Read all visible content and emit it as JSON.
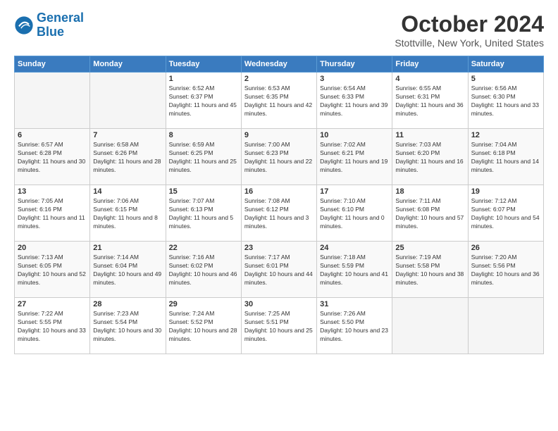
{
  "header": {
    "logo_line1": "General",
    "logo_line2": "Blue",
    "month": "October 2024",
    "location": "Stottville, New York, United States"
  },
  "weekdays": [
    "Sunday",
    "Monday",
    "Tuesday",
    "Wednesday",
    "Thursday",
    "Friday",
    "Saturday"
  ],
  "weeks": [
    [
      {
        "day": "",
        "empty": true
      },
      {
        "day": "",
        "empty": true
      },
      {
        "day": "1",
        "sunrise": "Sunrise: 6:52 AM",
        "sunset": "Sunset: 6:37 PM",
        "daylight": "Daylight: 11 hours and 45 minutes."
      },
      {
        "day": "2",
        "sunrise": "Sunrise: 6:53 AM",
        "sunset": "Sunset: 6:35 PM",
        "daylight": "Daylight: 11 hours and 42 minutes."
      },
      {
        "day": "3",
        "sunrise": "Sunrise: 6:54 AM",
        "sunset": "Sunset: 6:33 PM",
        "daylight": "Daylight: 11 hours and 39 minutes."
      },
      {
        "day": "4",
        "sunrise": "Sunrise: 6:55 AM",
        "sunset": "Sunset: 6:31 PM",
        "daylight": "Daylight: 11 hours and 36 minutes."
      },
      {
        "day": "5",
        "sunrise": "Sunrise: 6:56 AM",
        "sunset": "Sunset: 6:30 PM",
        "daylight": "Daylight: 11 hours and 33 minutes."
      }
    ],
    [
      {
        "day": "6",
        "sunrise": "Sunrise: 6:57 AM",
        "sunset": "Sunset: 6:28 PM",
        "daylight": "Daylight: 11 hours and 30 minutes."
      },
      {
        "day": "7",
        "sunrise": "Sunrise: 6:58 AM",
        "sunset": "Sunset: 6:26 PM",
        "daylight": "Daylight: 11 hours and 28 minutes."
      },
      {
        "day": "8",
        "sunrise": "Sunrise: 6:59 AM",
        "sunset": "Sunset: 6:25 PM",
        "daylight": "Daylight: 11 hours and 25 minutes."
      },
      {
        "day": "9",
        "sunrise": "Sunrise: 7:00 AM",
        "sunset": "Sunset: 6:23 PM",
        "daylight": "Daylight: 11 hours and 22 minutes."
      },
      {
        "day": "10",
        "sunrise": "Sunrise: 7:02 AM",
        "sunset": "Sunset: 6:21 PM",
        "daylight": "Daylight: 11 hours and 19 minutes."
      },
      {
        "day": "11",
        "sunrise": "Sunrise: 7:03 AM",
        "sunset": "Sunset: 6:20 PM",
        "daylight": "Daylight: 11 hours and 16 minutes."
      },
      {
        "day": "12",
        "sunrise": "Sunrise: 7:04 AM",
        "sunset": "Sunset: 6:18 PM",
        "daylight": "Daylight: 11 hours and 14 minutes."
      }
    ],
    [
      {
        "day": "13",
        "sunrise": "Sunrise: 7:05 AM",
        "sunset": "Sunset: 6:16 PM",
        "daylight": "Daylight: 11 hours and 11 minutes."
      },
      {
        "day": "14",
        "sunrise": "Sunrise: 7:06 AM",
        "sunset": "Sunset: 6:15 PM",
        "daylight": "Daylight: 11 hours and 8 minutes."
      },
      {
        "day": "15",
        "sunrise": "Sunrise: 7:07 AM",
        "sunset": "Sunset: 6:13 PM",
        "daylight": "Daylight: 11 hours and 5 minutes."
      },
      {
        "day": "16",
        "sunrise": "Sunrise: 7:08 AM",
        "sunset": "Sunset: 6:12 PM",
        "daylight": "Daylight: 11 hours and 3 minutes."
      },
      {
        "day": "17",
        "sunrise": "Sunrise: 7:10 AM",
        "sunset": "Sunset: 6:10 PM",
        "daylight": "Daylight: 11 hours and 0 minutes."
      },
      {
        "day": "18",
        "sunrise": "Sunrise: 7:11 AM",
        "sunset": "Sunset: 6:08 PM",
        "daylight": "Daylight: 10 hours and 57 minutes."
      },
      {
        "day": "19",
        "sunrise": "Sunrise: 7:12 AM",
        "sunset": "Sunset: 6:07 PM",
        "daylight": "Daylight: 10 hours and 54 minutes."
      }
    ],
    [
      {
        "day": "20",
        "sunrise": "Sunrise: 7:13 AM",
        "sunset": "Sunset: 6:05 PM",
        "daylight": "Daylight: 10 hours and 52 minutes."
      },
      {
        "day": "21",
        "sunrise": "Sunrise: 7:14 AM",
        "sunset": "Sunset: 6:04 PM",
        "daylight": "Daylight: 10 hours and 49 minutes."
      },
      {
        "day": "22",
        "sunrise": "Sunrise: 7:16 AM",
        "sunset": "Sunset: 6:02 PM",
        "daylight": "Daylight: 10 hours and 46 minutes."
      },
      {
        "day": "23",
        "sunrise": "Sunrise: 7:17 AM",
        "sunset": "Sunset: 6:01 PM",
        "daylight": "Daylight: 10 hours and 44 minutes."
      },
      {
        "day": "24",
        "sunrise": "Sunrise: 7:18 AM",
        "sunset": "Sunset: 5:59 PM",
        "daylight": "Daylight: 10 hours and 41 minutes."
      },
      {
        "day": "25",
        "sunrise": "Sunrise: 7:19 AM",
        "sunset": "Sunset: 5:58 PM",
        "daylight": "Daylight: 10 hours and 38 minutes."
      },
      {
        "day": "26",
        "sunrise": "Sunrise: 7:20 AM",
        "sunset": "Sunset: 5:56 PM",
        "daylight": "Daylight: 10 hours and 36 minutes."
      }
    ],
    [
      {
        "day": "27",
        "sunrise": "Sunrise: 7:22 AM",
        "sunset": "Sunset: 5:55 PM",
        "daylight": "Daylight: 10 hours and 33 minutes."
      },
      {
        "day": "28",
        "sunrise": "Sunrise: 7:23 AM",
        "sunset": "Sunset: 5:54 PM",
        "daylight": "Daylight: 10 hours and 30 minutes."
      },
      {
        "day": "29",
        "sunrise": "Sunrise: 7:24 AM",
        "sunset": "Sunset: 5:52 PM",
        "daylight": "Daylight: 10 hours and 28 minutes."
      },
      {
        "day": "30",
        "sunrise": "Sunrise: 7:25 AM",
        "sunset": "Sunset: 5:51 PM",
        "daylight": "Daylight: 10 hours and 25 minutes."
      },
      {
        "day": "31",
        "sunrise": "Sunrise: 7:26 AM",
        "sunset": "Sunset: 5:50 PM",
        "daylight": "Daylight: 10 hours and 23 minutes."
      },
      {
        "day": "",
        "empty": true
      },
      {
        "day": "",
        "empty": true
      }
    ]
  ]
}
